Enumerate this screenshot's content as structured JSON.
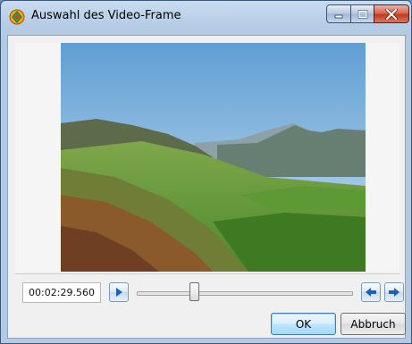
{
  "window": {
    "title": "Auswahl des Video-Frame"
  },
  "video": {
    "description_icon": "landscape-video-frame"
  },
  "controls": {
    "time": "00:02:29.560",
    "play_icon": "play-icon",
    "prev_icon": "arrow-left-icon",
    "next_icon": "arrow-right-icon",
    "slider_position": 0.27
  },
  "buttons": {
    "ok": "OK",
    "cancel": "Abbruch"
  },
  "colors": {
    "accent": "#1b62b8",
    "close": "#c23a1e"
  }
}
